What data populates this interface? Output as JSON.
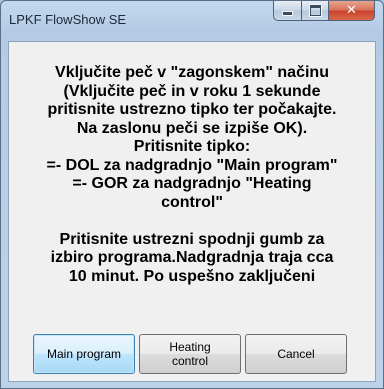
{
  "window": {
    "title": "LPKF FlowShow SE",
    "caption_buttons": {
      "minimize": "minimize",
      "maximize": "maximize",
      "close": "✕"
    }
  },
  "message": "Vključite peč v \"zagonskem\" načinu\n(Vključite peč in v roku 1 sekunde\npritisnite ustrezno tipko ter počakajte.\nNa zaslonu peči se izpiše OK).\nPritisnite tipko:\n=- DOL za nadgradnjo \"Main program\"\n=- GOR za nadgradnjo \"Heating\ncontrol\"\n\nPritisnite ustrezni spodnji gumb za\nizbiro programa.Nadgradnja traja cca\n10 minut. Po uspešno zaključeni",
  "buttons": {
    "main_program": "Main program",
    "heating_control": "Heating\ncontrol",
    "cancel": "Cancel"
  }
}
